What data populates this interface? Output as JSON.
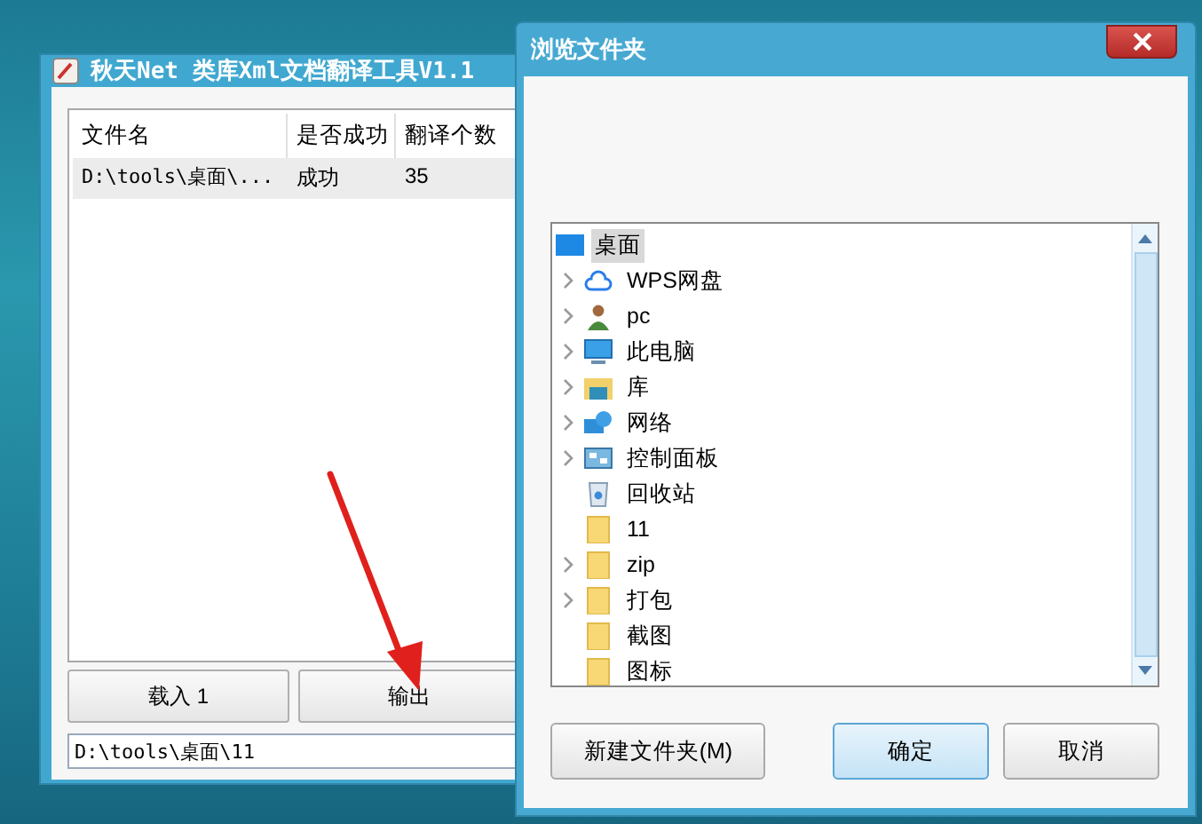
{
  "main_window": {
    "title": "秋天Net 类库Xml文档翻译工具V1.1",
    "table": {
      "columns": [
        "文件名",
        "是否成功",
        "翻译个数"
      ],
      "rows": [
        {
          "cells": [
            "D:\\tools\\桌面\\...",
            "成功",
            "35"
          ],
          "selected": true
        }
      ]
    },
    "buttons": [
      "载入 1",
      "输出"
    ],
    "path_field": {
      "value": "D:\\tools\\桌面\\11"
    }
  },
  "dialog": {
    "title": "浏览文件夹",
    "tree": [
      {
        "label": "桌面",
        "selected": true,
        "children": [
          {
            "label": "WPS网盘",
            "kind": "cloud",
            "expandable": true,
            "selected": false
          },
          {
            "label": "pc",
            "kind": "user",
            "expandable": true,
            "selected": false
          },
          {
            "label": "此电脑",
            "kind": "computer",
            "expandable": true,
            "selected": false
          },
          {
            "label": "库",
            "kind": "library",
            "expandable": true,
            "selected": false
          },
          {
            "label": "网络",
            "kind": "network",
            "expandable": true,
            "selected": false
          },
          {
            "label": "控制面板",
            "kind": "control-panel",
            "expandable": true,
            "selected": false
          },
          {
            "label": "回收站",
            "kind": "recycle-bin",
            "expandable": false,
            "selected": false
          },
          {
            "label": "11",
            "kind": "folder",
            "expandable": false,
            "selected": false
          },
          {
            "label": "zip",
            "kind": "folder",
            "expandable": true,
            "selected": false
          },
          {
            "label": "打包",
            "kind": "folder",
            "expandable": true,
            "selected": false
          },
          {
            "label": "截图",
            "kind": "folder",
            "expandable": false,
            "selected": false
          },
          {
            "label": "图标",
            "kind": "folder",
            "expandable": false,
            "selected": false
          }
        ]
      }
    ],
    "buttons": [
      {
        "label": "新建文件夹(M)",
        "default": false
      },
      {
        "label": "确定",
        "default": true
      },
      {
        "label": "取消",
        "default": false
      }
    ]
  }
}
